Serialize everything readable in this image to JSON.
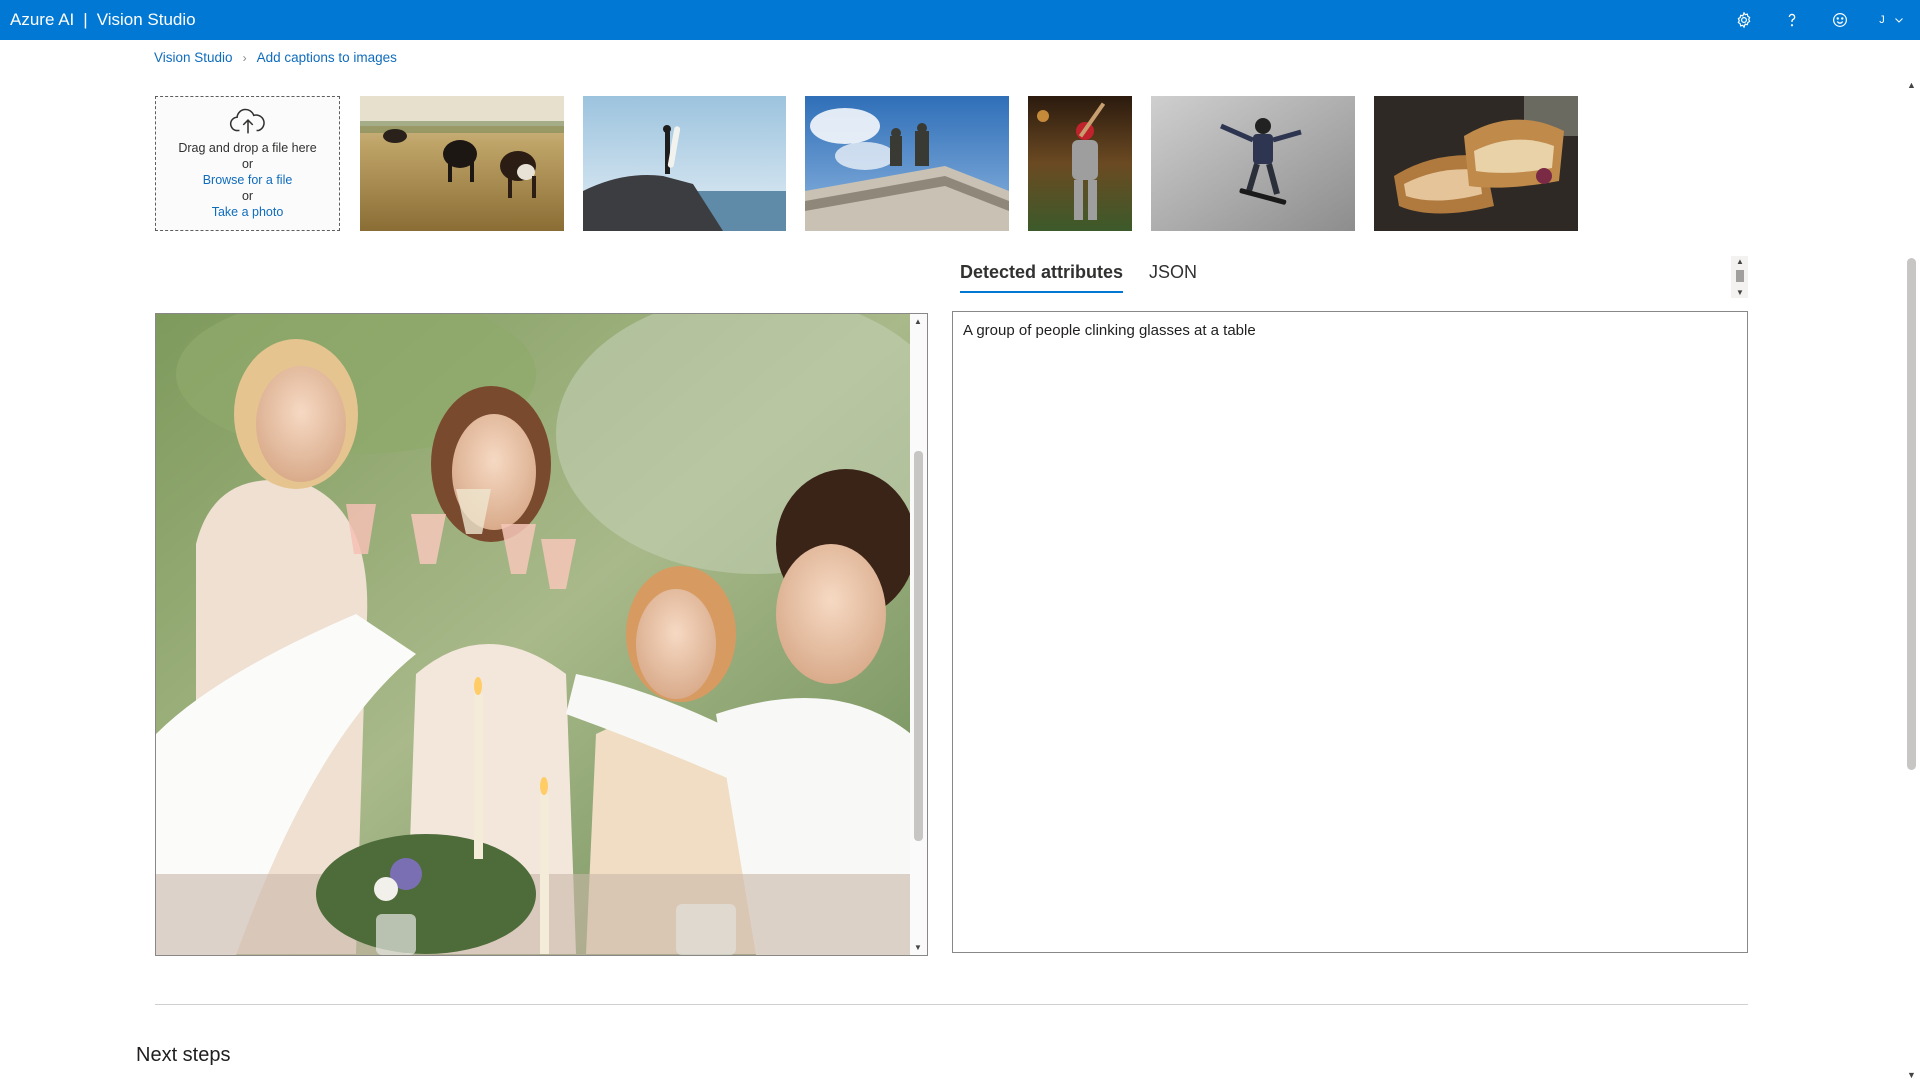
{
  "app": {
    "brand": "Azure AI",
    "separator": "|",
    "product": "Vision Studio",
    "account_initial": "J"
  },
  "colors": {
    "header": "#0078d4",
    "link": "#0f6cbd",
    "tab_underline": "#0078d4"
  },
  "top_icons": [
    "gear-icon",
    "help-icon",
    "feedback-smiley-icon",
    "chevron-down-icon"
  ],
  "breadcrumb": {
    "root": "Vision Studio",
    "separator": "›",
    "current": "Add captions to images"
  },
  "upload": {
    "drag_text": "Drag and drop a file here",
    "or1": "or",
    "browse": "Browse for a file",
    "or2": "or",
    "photo": "Take a photo"
  },
  "samples": [
    "cows-grazing",
    "surfer-on-rock",
    "building-statues",
    "baseball-batter",
    "skateboarder",
    "grilled-sandwich"
  ],
  "tabs": {
    "detected": "Detected attributes",
    "json": "JSON"
  },
  "result": {
    "caption": "A group of people clinking glasses at a table"
  },
  "footer": {
    "next_steps": "Next steps"
  }
}
